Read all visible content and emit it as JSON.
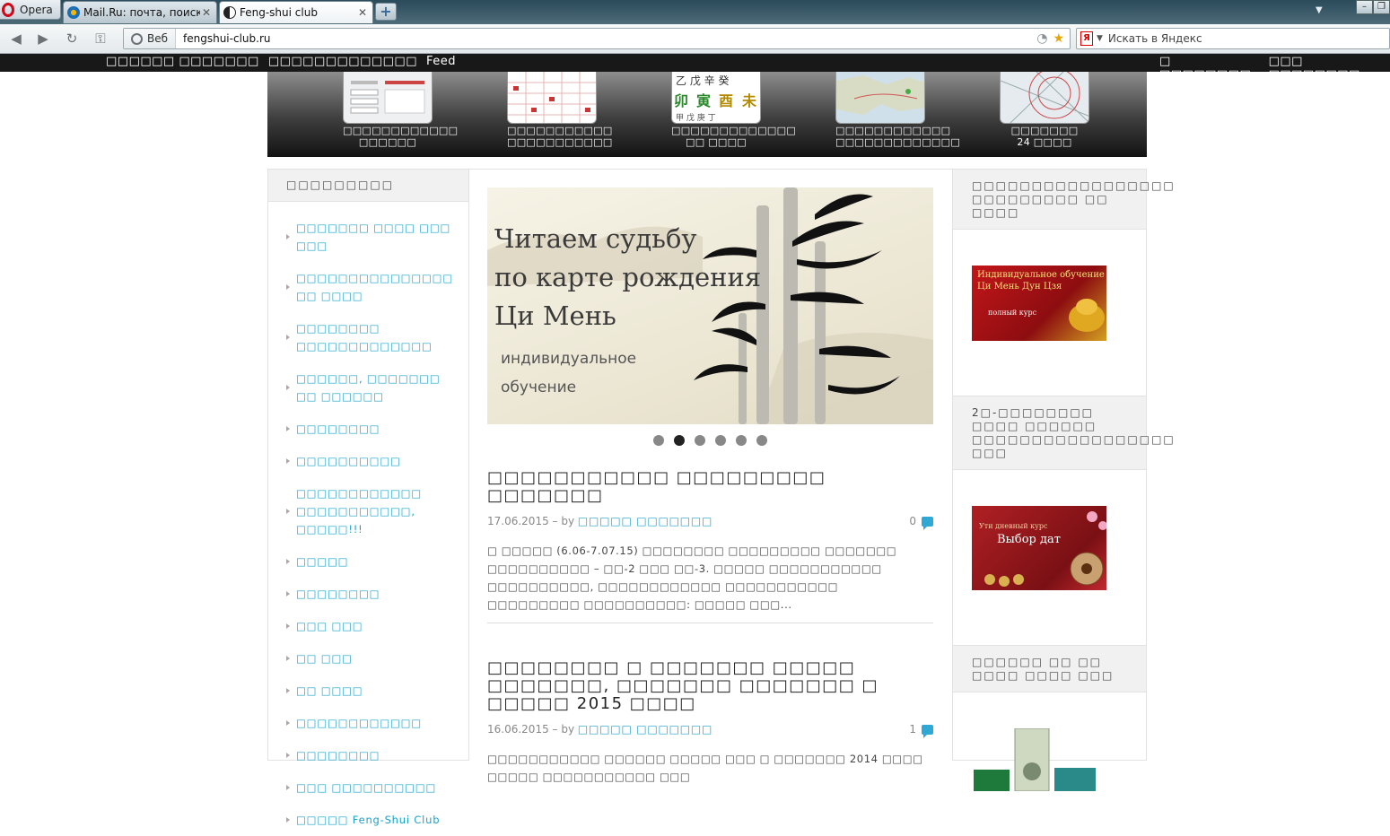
{
  "browser": {
    "menu_label": "Opera",
    "tabs": [
      {
        "label": "Mail.Ru: почта, поиск ..."
      },
      {
        "label": "Feng-shui club"
      }
    ],
    "address_badge": "Веб",
    "url": "fengshui-club.ru",
    "search_placeholder": "Искать в Яндекс",
    "search_icon_text": "Я"
  },
  "site_nav": {
    "left": [
      "□□□□□□ □□□□□□□",
      "□□□□□□□□□□□□□",
      "Feed"
    ],
    "right": [
      "□ □□□□□□□□",
      "□□□ □□□□□□□□"
    ]
  },
  "features": [
    {
      "line1": "□□□□□□□□□□□□",
      "line2": "□□□□□□"
    },
    {
      "line1": "□□□□□□□□□□□",
      "line2": "□□□□□□□□□□□"
    },
    {
      "line1": "□□□□□□□□□□□□□",
      "line2": "□□ □□□□"
    },
    {
      "line1": "□□□□□□□□□□□□",
      "line2": "□□□□□□□□□□□□□"
    },
    {
      "line1": "□□□□□□□",
      "line2": "24 □□□□"
    }
  ],
  "sidebar": {
    "heading": "□□□□□□□□□",
    "items": [
      "□□□□□□□ □□□□ □□□ □□□",
      "□□□□□□□□□□□□□□□ □□ □□□□",
      "□□□□□□□□ □□□□□□□□□□□□□",
      "□□□□□□, □□□□□□□ □□ □□□□□□",
      "□□□□□□□□",
      "□□□□□□□□□□",
      "□□□□□□□□□□□□ □□□□□□□□□□□, □□□□□!!!",
      "□□□□□",
      "□□□□□□□□",
      "□□□ □□□",
      "□□ □□□",
      "□□ □□□□",
      "□□□□□□□□□□□□",
      "□□□□□□□□",
      "□□□ □□□□□□□□□□",
      "□□□□□ Feng-Shui Club"
    ]
  },
  "slider": {
    "title_lines": [
      "Читаем судьбу",
      "по карте рождения",
      "Ци Мень"
    ],
    "subtitle_lines": [
      "индивидуальное",
      "обучение"
    ],
    "active_dot": 2,
    "dot_count": 6
  },
  "posts": [
    {
      "title": "□□□□□□□□□□□ □□□□□□□□□ □□□□□□□",
      "date": "17.06.2015",
      "by": " – by ",
      "author": "□□□□□ □□□□□□□",
      "comments": "0",
      "excerpt": "□ □□□□□ (6.06-7.07.15) □□□□□□□□ □□□□□□□□□ □□□□□□□ □□□□□□□□□□ – □□-2 □□□ □□-3. □□□□□ □□□□□□□□□□□ □□□□□□□□□□, □□□□□□□□□□□□ □□□□□□□□□□□ □□□□□□□□□ □□□□□□□□□□: □□□□□ □□□..."
    },
    {
      "title": "□□□□□□□□ □ □□□□□□□ □□□□□ □□□□□□□, □□□□□□□ □□□□□□□ □ □□□□□ 2015 □□□□",
      "date": "16.06.2015",
      "by": " – by ",
      "author": "□□□□□ □□□□□□□",
      "comments": "1",
      "excerpt": "□□□□□□□□□□□ □□□□□□ □□□□□ □□□ □ □□□□□□□ 2014 □□□□ □□□□□ □□□□□□□□□□□ □□□"
    }
  ],
  "widgets": [
    {
      "heading": "□□□□□□□□□□□□□□□□□ □□□□□□□□□ □□ □□□□",
      "ad_lines": [
        "Индивидуальное обучение",
        "Ци Мень Дун Цзя"
      ],
      "ad_note": "полный курс"
    },
    {
      "heading": "2□-□□□□□□□□ □□□□ □□□□□□ □□□□□□□□□□□□□□□□□ □□□",
      "ad_lines": [
        "Выбор дат"
      ],
      "ad_note": "Ути дневный курс"
    },
    {
      "heading": "□□□□□□ □□ □□ □□□□ □□□□ □□□"
    }
  ],
  "colors": {
    "link": "#1aa1c9",
    "nav_bg": "#181818",
    "comment_bubble": "#2fa8d5"
  }
}
